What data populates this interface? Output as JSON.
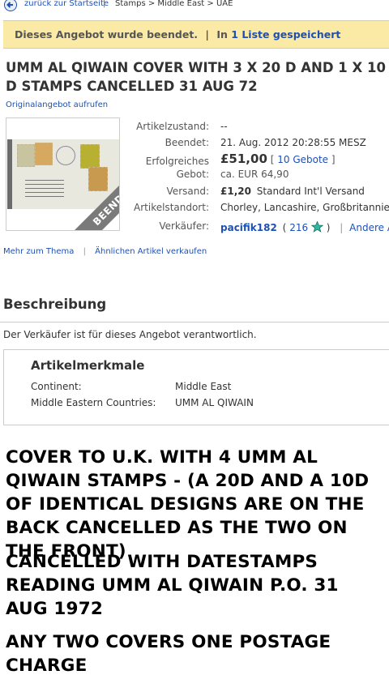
{
  "nav": {
    "back_label": "zurück zur Startseite",
    "separator": "|",
    "breadcrumb": "Stamps > Middle East > UAE"
  },
  "banner": {
    "text_prefix": "Dieses Angebot wurde beendet.",
    "pipe": "|",
    "in_label": "In",
    "count": "1",
    "saved_label": "Liste gespeichert"
  },
  "listing": {
    "title": "UMM AL QIWAIN COVER WITH 3 X 20 D AND 1 X 10 D STAMPS CANCELLED 31 AUG 72",
    "original_link": "Originalangebot aufrufen",
    "ribbon": "BEENDET"
  },
  "details": {
    "condition_label": "Artikelzustand:",
    "condition_value": "--",
    "ended_label": "Beendet:",
    "ended_value": "21. Aug. 2012 20:28:55 MESZ",
    "bid_label_1": "Erfolgreiches",
    "bid_label_2": "Gebot:",
    "price": "£51,00",
    "bids_open": "[",
    "bids": "10 Gebote",
    "bids_close": "]",
    "price_eur": "ca. EUR 64,90",
    "shipping_label": "Versand:",
    "shipping_price": "£1,20",
    "shipping_method": "Standard Int'l Versand",
    "location_label": "Artikelstandort:",
    "location_value": "Chorley, Lancashire, Großbritannien",
    "seller_label": "Verkäufer:",
    "seller_name": "pacifik182",
    "seller_open": "(",
    "seller_score": "216",
    "seller_close": ")",
    "other_sep": "|",
    "other_items": "Andere Art"
  },
  "links": {
    "more": "Mehr zum Thema",
    "sep": "|",
    "sell_similar": "Ähnlichen Artikel verkaufen"
  },
  "description": {
    "heading": "Beschreibung",
    "responsibility": "Der Verkäufer ist für dieses Angebot verantwortlich.",
    "specs_title": "Artikelmerkmale",
    "spec1_label": "Continent:",
    "spec1_value": "Middle East",
    "spec2_label": "Middle Eastern Countries:",
    "spec2_value": "UMM AL QIWAIN",
    "para1": "COVER TO U.K. WITH 4 UMM AL QIWAIN STAMPS - (A 20D AND A 10D OF IDENTICAL DESIGNS ARE ON THE BACK CANCELLED AS THE TWO ON THE FRONT)",
    "para2": "CANCELLED WITH DATESTAMPS READING UMM AL QIWAIN P.O. 31 AUG 1972",
    "para3": "ANY TWO COVERS ONE POSTAGE CHARGE"
  },
  "colors": {
    "link": "#1e50b3",
    "banner_bg": "#fbe9a6",
    "ribbon": "#7a7a7a",
    "star": "#2fb8a0"
  }
}
